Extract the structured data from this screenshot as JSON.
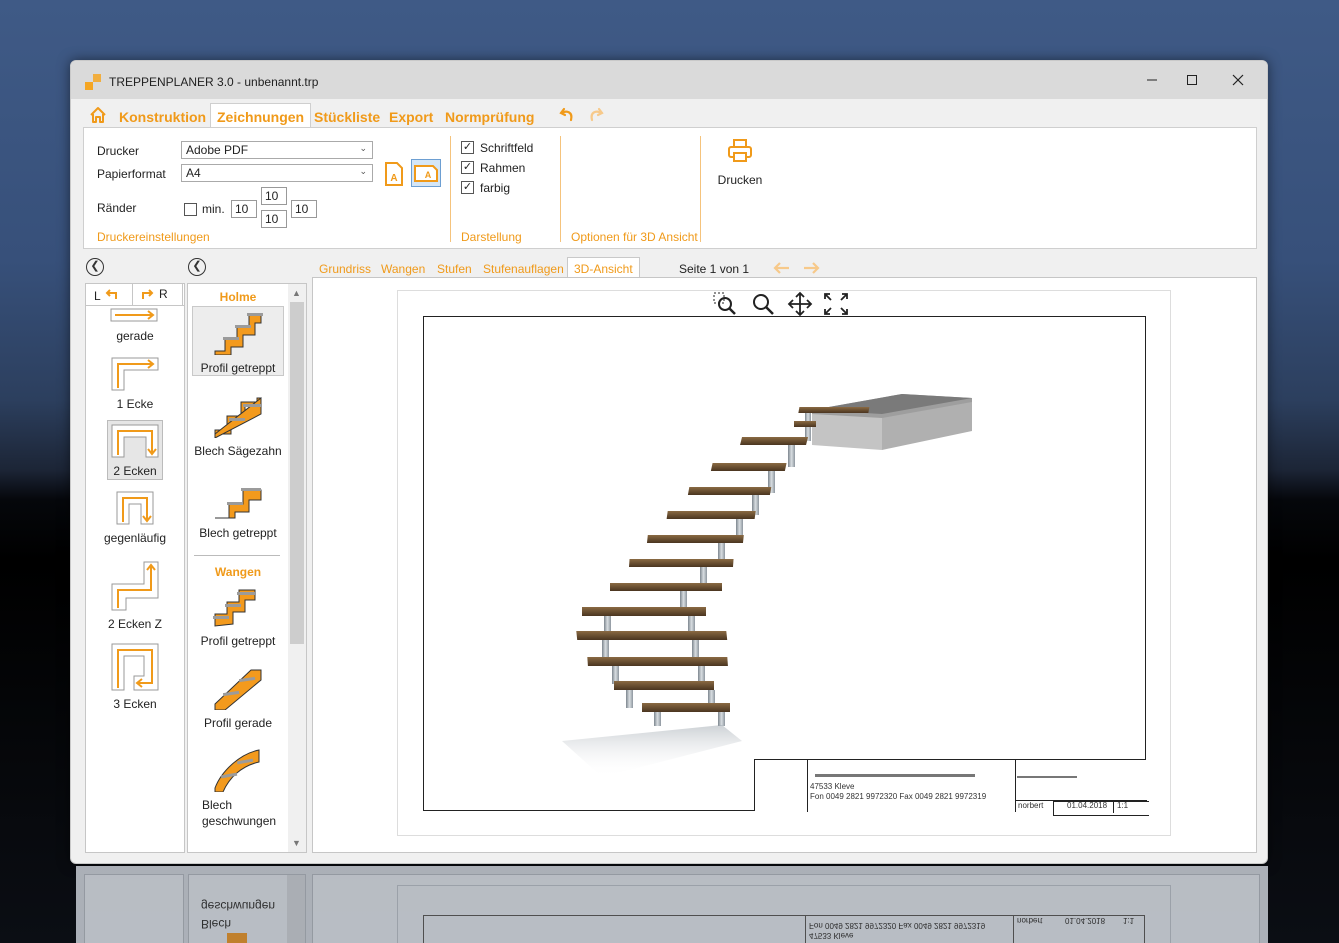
{
  "window": {
    "title": "TREPPENPLANER 3.0 - unbenannt.trp"
  },
  "menu": [
    "Konstruktion",
    "Zeichnungen",
    "Stückliste",
    "Export",
    "Normprüfung"
  ],
  "printer": {
    "drucker_label": "Drucker",
    "drucker_value": "Adobe PDF",
    "papierformat_label": "Papierformat",
    "papierformat_value": "A4",
    "raender_label": "Ränder",
    "min_label": "min.",
    "margin_left": "10",
    "margin_top": "10",
    "margin_bottom": "10",
    "margin_right": "10",
    "group_title": "Druckereinstellungen"
  },
  "darstellung": {
    "items": [
      {
        "label": "Schriftfeld",
        "checked": true
      },
      {
        "label": "Rahmen",
        "checked": true
      },
      {
        "label": "farbig",
        "checked": true
      }
    ],
    "group_title": "Darstellung"
  },
  "options3d": {
    "group_title": "Optionen für 3D Ansicht"
  },
  "print": {
    "label": "Drucken"
  },
  "side": {
    "tab_left": "L",
    "tab_right": "R",
    "shapes": [
      "gerade",
      "1 Ecke",
      "2 Ecken",
      "gegenläufig",
      "2 Ecken Z",
      "3 Ecken"
    ],
    "selected_shape": "2 Ecken"
  },
  "profiles": {
    "holme_title": "Holme",
    "holme": [
      "Profil getreppt",
      "Blech Sägezahn",
      "Blech getreppt"
    ],
    "wangen_title": "Wangen",
    "wangen": [
      "Profil getreppt",
      "Profil gerade",
      "Blech geschwungen"
    ]
  },
  "tabs": [
    "Grundriss",
    "Wangen",
    "Stufen",
    "Stufenauflagen",
    "3D-Ansicht"
  ],
  "active_tab": "3D-Ansicht",
  "page_indicator": "Seite 1 von 1",
  "title_block": {
    "address_line1": "47533 Kleve",
    "address_line2": "Fon 0049 2821 9972320  Fax 0049 2821 9972319",
    "author": "norbert",
    "date": "01.04.2018",
    "scale": "1:1"
  },
  "reflection": {
    "line1": "Blech",
    "line2": "geschwungen",
    "addr1": "47533 Kleve",
    "addr2": "Fon 0049 2821 9972320  Fax 0049 2821 9972319",
    "author": "norbert",
    "date": "01.04.2018",
    "scale": "1:1"
  },
  "colors": {
    "accent": "#f09a1a",
    "wood": "#6b4e2e",
    "steel": "#9aa3ab"
  }
}
